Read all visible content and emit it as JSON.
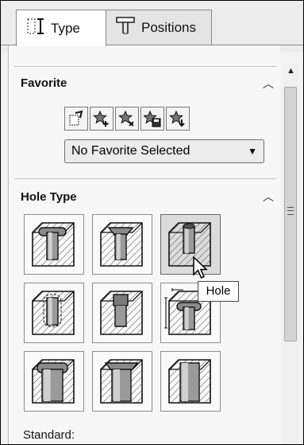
{
  "tabs": [
    {
      "label": "Type",
      "icon": "hole-type-icon"
    },
    {
      "label": "Positions",
      "icon": "positions-icon"
    }
  ],
  "favorite": {
    "title": "Favorite",
    "buttons": [
      "apply-defaults-icon",
      "add-favorite-icon",
      "delete-favorite-icon",
      "save-favorite-icon",
      "load-favorite-icon"
    ],
    "selected": "No Favorite Selected"
  },
  "hole_type": {
    "title": "Hole Type",
    "types": [
      "counterbore",
      "countersink",
      "hole",
      "straight-tap",
      "tapered-tap",
      "legacy",
      "counterbore-slot",
      "countersink-slot",
      "slot"
    ],
    "selected": "hole",
    "tooltip": "Hole"
  },
  "standard_label": "Standard:"
}
